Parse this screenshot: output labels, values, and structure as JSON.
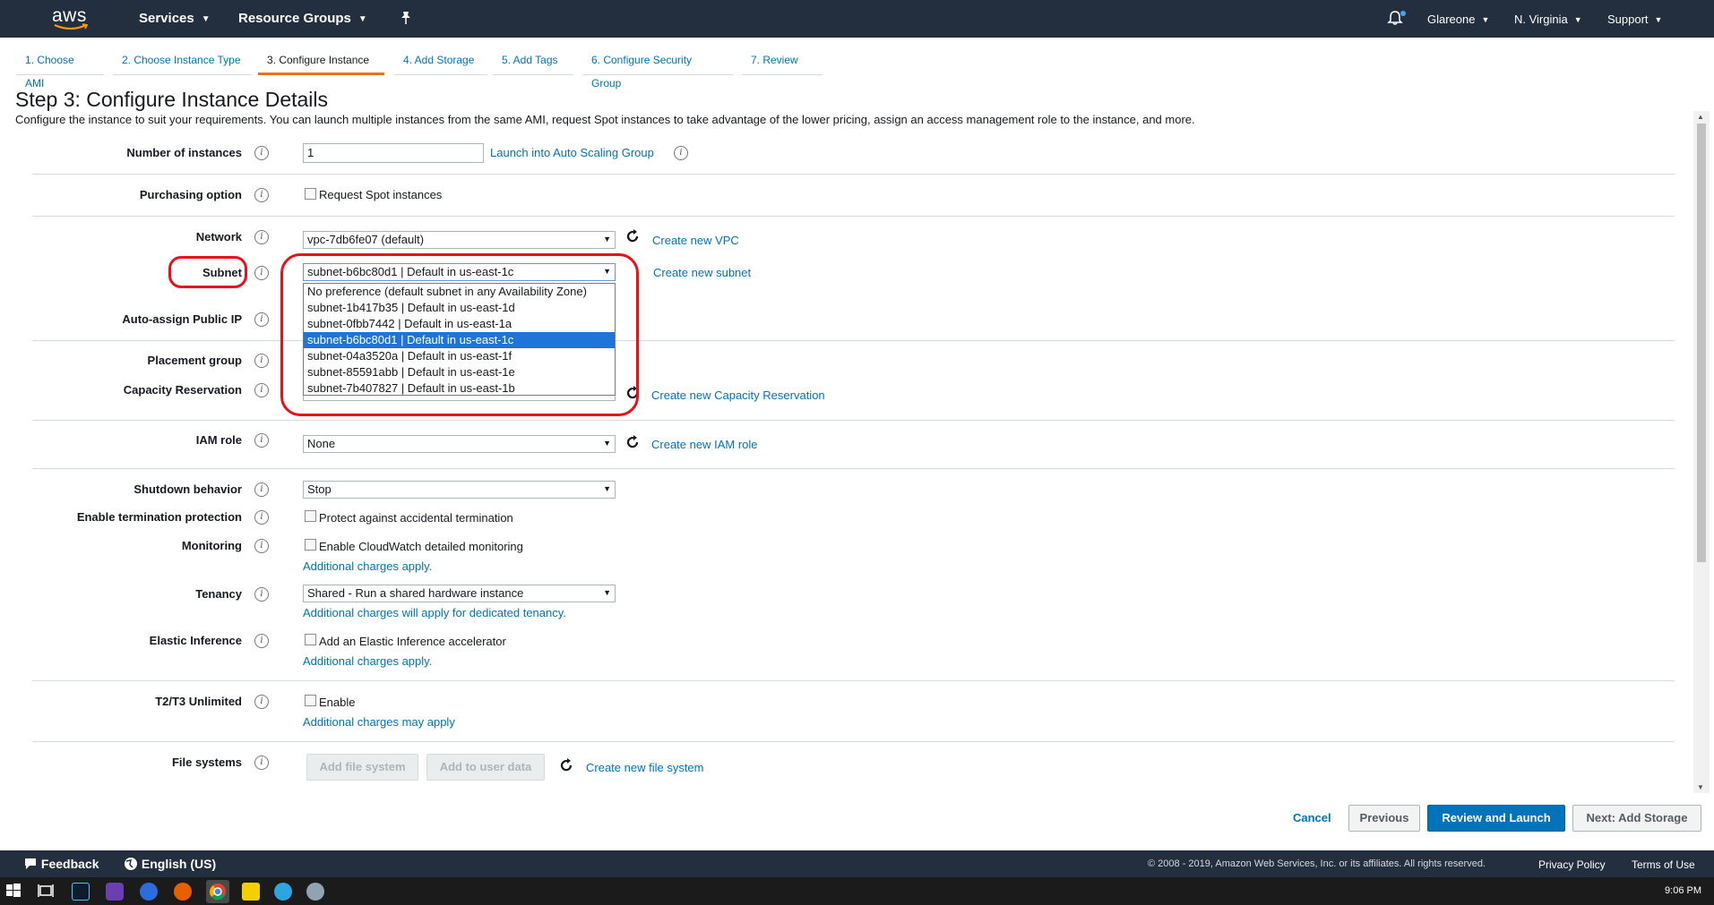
{
  "topnav": {
    "logo": "aws",
    "services": "Services",
    "resource_groups": "Resource Groups",
    "account": "Glareone",
    "region": "N. Virginia",
    "support": "Support",
    "icons": [
      "pin-icon",
      "bell-icon"
    ]
  },
  "wizard": {
    "tabs": [
      "1. Choose AMI",
      "2. Choose Instance Type",
      "3. Configure Instance",
      "4. Add Storage",
      "5. Add Tags",
      "6. Configure Security Group",
      "7. Review"
    ],
    "active_index": 2
  },
  "page": {
    "title": "Step 3: Configure Instance Details",
    "subtitle": "Configure the instance to suit your requirements. You can launch multiple instances from the same AMI, request Spot instances to take advantage of the lower pricing, assign an access management role to the instance, and more."
  },
  "form": {
    "number_of_instances": {
      "label": "Number of instances",
      "value": "1",
      "link": "Launch into Auto Scaling Group"
    },
    "purchasing_option": {
      "label": "Purchasing option",
      "checkbox": "Request Spot instances"
    },
    "network": {
      "label": "Network",
      "value": "vpc-7db6fe07 (default)",
      "link": "Create new VPC"
    },
    "subnet": {
      "label": "Subnet",
      "value": "subnet-b6bc80d1 | Default in us-east-1c",
      "link": "Create new subnet",
      "options": [
        "No preference (default subnet in any Availability Zone)",
        "subnet-1b417b35 | Default in us-east-1d",
        "subnet-0fbb7442 | Default in us-east-1a",
        "subnet-b6bc80d1 | Default in us-east-1c",
        "subnet-04a3520a | Default in us-east-1f",
        "subnet-85591abb | Default in us-east-1e",
        "subnet-7b407827 | Default in us-east-1b"
      ],
      "selected_index": 3
    },
    "auto_assign_ip": {
      "label": "Auto-assign Public IP"
    },
    "placement_group": {
      "label": "Placement group"
    },
    "capacity_reservation": {
      "label": "Capacity Reservation",
      "link": "Create new Capacity Reservation"
    },
    "iam_role": {
      "label": "IAM role",
      "value": "None",
      "link": "Create new IAM role"
    },
    "shutdown_behavior": {
      "label": "Shutdown behavior",
      "value": "Stop"
    },
    "termination_protection": {
      "label": "Enable termination protection",
      "checkbox": "Protect against accidental termination"
    },
    "monitoring": {
      "label": "Monitoring",
      "checkbox": "Enable CloudWatch detailed monitoring",
      "note": "Additional charges apply."
    },
    "tenancy": {
      "label": "Tenancy",
      "value": "Shared - Run a shared hardware instance",
      "note": "Additional charges will apply for dedicated tenancy."
    },
    "elastic_inference": {
      "label": "Elastic Inference",
      "checkbox": "Add an Elastic Inference accelerator",
      "note": "Additional charges apply."
    },
    "t2t3_unlimited": {
      "label": "T2/T3 Unlimited",
      "checkbox": "Enable",
      "note": "Additional charges may apply"
    },
    "file_systems": {
      "label": "File systems",
      "add_fs": "Add file system",
      "add_user_data": "Add to user data",
      "link": "Create new file system"
    }
  },
  "actions": {
    "cancel": "Cancel",
    "previous": "Previous",
    "review_launch": "Review and Launch",
    "next": "Next: Add Storage"
  },
  "footer": {
    "feedback": "Feedback",
    "language": "English (US)",
    "copyright": "© 2008 - 2019, Amazon Web Services, Inc. or its affiliates. All rights reserved.",
    "privacy": "Privacy Policy",
    "terms": "Terms of Use"
  },
  "taskbar": {
    "clock": "9:06 PM"
  },
  "colors": {
    "nav_bg": "#232f3e",
    "link": "#0073bb",
    "primary_button": "#0073bb",
    "active_tab": "#ec7211",
    "highlight": "#e8111a",
    "selected_option": "#1e74d8"
  }
}
